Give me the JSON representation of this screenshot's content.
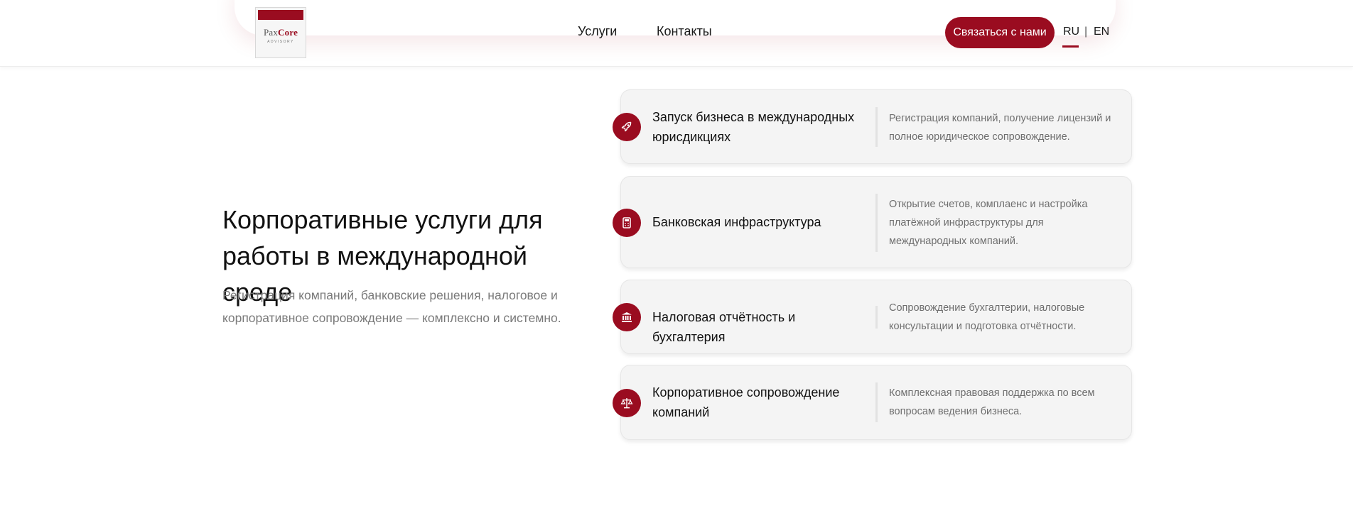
{
  "header": {
    "logo": {
      "name_part1": "Pax",
      "name_part2": "Core",
      "subtitle": "ADVISORY"
    },
    "nav": {
      "services": "Услуги",
      "contacts": "Контакты"
    },
    "cta_label": "Связаться с нами",
    "lang": {
      "ru": "RU",
      "separator": "|",
      "en": "EN",
      "active": "RU"
    }
  },
  "hero": {
    "title": "Корпоративные услуги для работы в международной среде",
    "subtitle": "Регистрация компаний, банковские решения, налоговое и корпоративное сопровождение — комплексно и системно."
  },
  "services": [
    {
      "icon": "rocket-icon",
      "title": "Запуск бизнеса в международных юрисдикциях",
      "description": "Регистрация компаний, получение лицензий и полное юридическое сопровождение."
    },
    {
      "icon": "calculator-icon",
      "title": "Банковская инфраструктура",
      "description": "Открытие счетов, комплаенс и настройка платёжной инфраструктуры для международных компаний."
    },
    {
      "icon": "bank-building-icon",
      "title": "Налоговая отчётность и бухгалтерия",
      "description": "Сопровождение бухгалтерии, налоговые консультации и подготовка отчётности."
    },
    {
      "icon": "scales-icon",
      "title": "Корпоративное сопровождение компаний",
      "description": "Комплексная правовая поддержка по всем вопросам ведения бизнеса."
    }
  ],
  "colors": {
    "brand": "#9a0c20",
    "card_bg": "#f4f4f4",
    "muted_text": "#7a7a7a"
  }
}
